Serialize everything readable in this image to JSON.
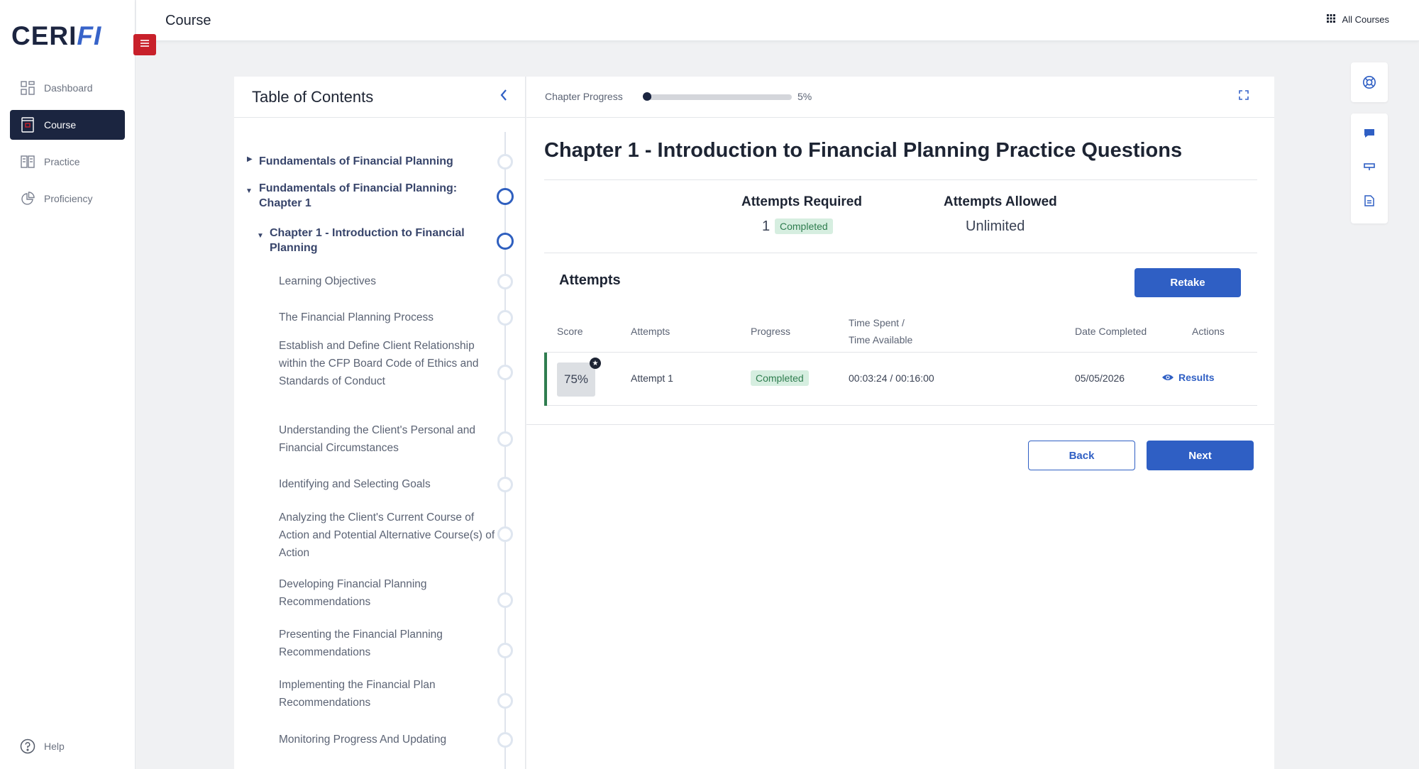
{
  "brand": {
    "logo_main": "CERI",
    "logo_accent": "FI"
  },
  "sidebar": {
    "items": [
      {
        "label": "Dashboard",
        "icon": "dashboard-icon",
        "active": false
      },
      {
        "label": "Course",
        "icon": "book-icon",
        "active": true
      },
      {
        "label": "Practice",
        "icon": "practice-icon",
        "active": false
      },
      {
        "label": "Proficiency",
        "icon": "pie-chart-icon",
        "active": false
      }
    ],
    "help_label": "Help"
  },
  "topbar": {
    "title": "Course",
    "all_courses_label": "All Courses"
  },
  "toc": {
    "title": "Table of Contents",
    "items": [
      {
        "label": "Fundamentals of Financial Planning",
        "level": 1,
        "arrow": "▶"
      },
      {
        "label": "Fundamentals of Financial Planning: Chapter 1",
        "level": 1,
        "arrow": "▼"
      },
      {
        "label": "Chapter 1 - Introduction to Financial Planning",
        "level": 1,
        "arrow": "▼"
      },
      {
        "label": "Learning Objectives",
        "level": 3
      },
      {
        "label": "The Financial Planning Process",
        "level": 3
      },
      {
        "label": "Establish and Define Client Relationship within the CFP Board Code of Ethics and Standards of Conduct",
        "level": 3
      },
      {
        "label": "Understanding the Client's Personal and Financial Circumstances",
        "level": 3
      },
      {
        "label": "Identifying and Selecting Goals",
        "level": 3
      },
      {
        "label": "Analyzing the Client's Current Course of Action and Potential Alternative Course(s) of Action",
        "level": 3
      },
      {
        "label": "Developing Financial Planning Recommendations",
        "level": 3
      },
      {
        "label": "Presenting the Financial Planning Recommendations",
        "level": 3
      },
      {
        "label": "Implementing the Financial Plan Recommendations",
        "level": 3
      },
      {
        "label": "Monitoring Progress And Updating",
        "level": 3
      }
    ]
  },
  "chapter_progress": {
    "label": "Chapter Progress",
    "percent_text": "5%",
    "value": 0.05
  },
  "chapter": {
    "title": "Chapter 1 - Introduction to Financial Planning Practice Questions",
    "attempts_required_label": "Attempts Required",
    "attempts_required_value": "1",
    "attempts_required_status": "Completed",
    "attempts_allowed_label": "Attempts Allowed",
    "attempts_allowed_value": "Unlimited"
  },
  "attempts": {
    "title": "Attempts",
    "retake_label": "Retake",
    "columns": {
      "score": "Score",
      "attempts": "Attempts",
      "progress": "Progress",
      "time_line1": "Time Spent /",
      "time_line2": "Time Available",
      "date": "Date Completed",
      "actions": "Actions"
    },
    "rows": [
      {
        "score": "75%",
        "attempt": "Attempt 1",
        "progress": "Completed",
        "time": "00:03:24 / 00:16:00",
        "date": "05/05/2026",
        "action": "Results"
      }
    ]
  },
  "footer_buttons": {
    "back": "Back",
    "next": "Next"
  },
  "colors": {
    "navy": "#1b2540",
    "primary": "#2f5fc4",
    "success": "#2f7d4f",
    "menu_red": "#c8202a"
  }
}
